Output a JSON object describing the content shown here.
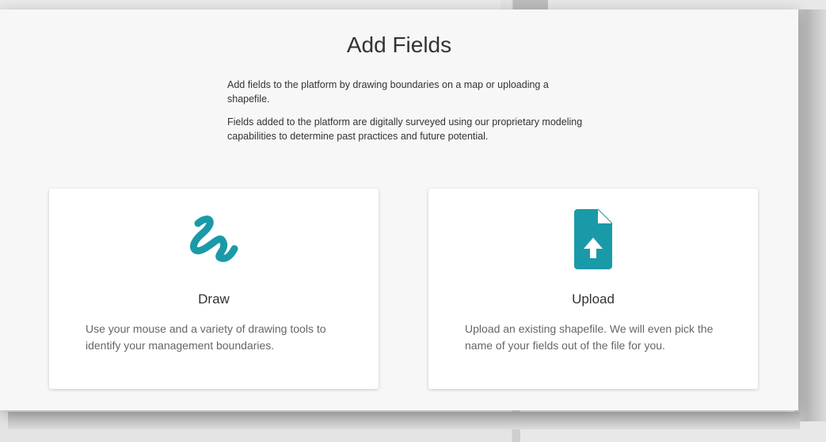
{
  "modal": {
    "title": "Add Fields",
    "intro": [
      "Add fields to the platform by drawing boundaries on a map or uploading a shapefile.",
      "Fields added to the platform are digitally surveyed using our proprietary modeling capabilities to determine past practices and future potential."
    ]
  },
  "options": [
    {
      "title": "Draw",
      "description": "Use your mouse and a variety of drawing tools to identify your management boundaries.",
      "icon": "squiggle-draw-icon"
    },
    {
      "title": "Upload",
      "description": "Upload an existing shapefile. We will even pick the name of your fields out of the file for you.",
      "icon": "file-upload-icon"
    }
  ],
  "colors": {
    "accent": "#1a9aa8",
    "modal_bg": "#f7f7f7",
    "card_bg": "#ffffff"
  }
}
